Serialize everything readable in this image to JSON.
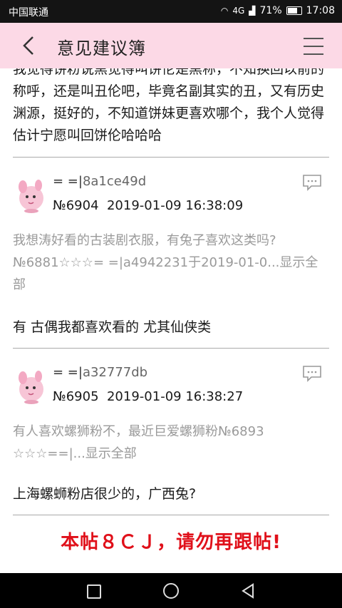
{
  "statusbar": {
    "carrier": "中国联通",
    "network": "4G",
    "battery": "71%",
    "time": "17:08"
  },
  "header": {
    "title": "意见建议簿"
  },
  "top_text": "我觉得饼粉说黑觉得叫饼伦是黑称，不知换回以前的称呼，还是叫丑伦吧，毕竟名副其实的丑，又有历史渊源，挺好的，不知道饼妹更喜欢哪个，我个人觉得估计宁愿叫回饼伦哈哈哈",
  "posts": [
    {
      "uid_prefix": "= =|",
      "uid_hash": "8a1ce49d",
      "number": "№6904",
      "datetime": "2019-01-09 16:38:09",
      "quote": "我想涛好看的古装剧衣服，有兔子喜欢这类吗?№6881☆☆☆= =|a4942231于2019-01-0...显示全部",
      "reply": "有  古偶我都喜欢看的  尤其仙侠类"
    },
    {
      "uid_prefix": "= =|",
      "uid_hash": "a32777db",
      "number": "№6905",
      "datetime": "2019-01-09 16:38:27",
      "quote": "有人喜欢螺狮粉不，最近巨爱螺狮粉№6893 ☆☆☆==|...显示全部",
      "reply": "上海螺蛳粉店很少的，广西兔?"
    }
  ],
  "notice": "本帖８ＣＪ，请勿再跟帖!",
  "colors": {
    "header_bg": "#fcd9e6",
    "notice": "#e0101a",
    "quote": "#9a9a9a"
  }
}
